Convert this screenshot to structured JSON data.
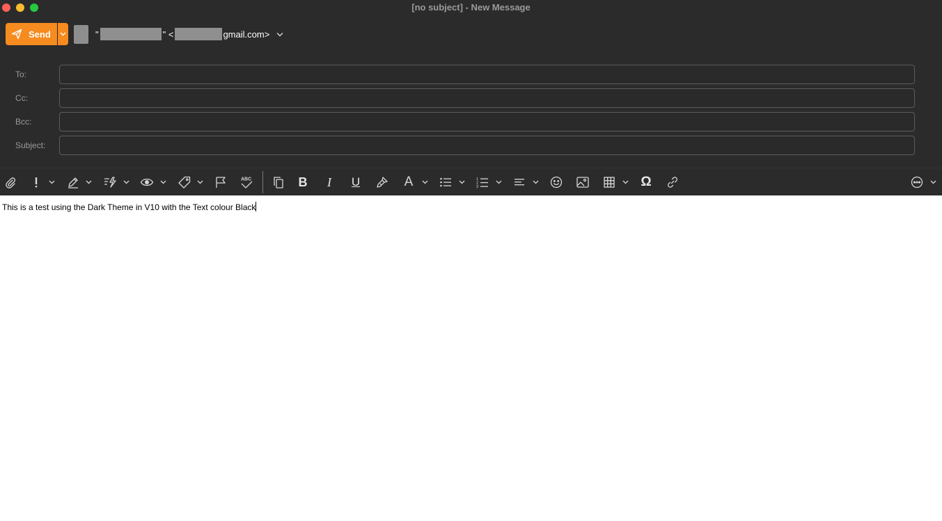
{
  "window": {
    "title": "[no subject] - New Message"
  },
  "send": {
    "label": "Send",
    "color": "#f68b1f"
  },
  "from": {
    "name_prefix": "\"",
    "name_suffix": "\" <",
    "email_suffix": "gmail.com>"
  },
  "fields": {
    "to_label": "To:",
    "cc_label": "Cc:",
    "bcc_label": "Bcc:",
    "subject_label": "Subject:",
    "to_value": "",
    "cc_value": "",
    "bcc_value": "",
    "subject_value": ""
  },
  "toolbar": {
    "icons": [
      "paperclip-icon",
      "importance-icon",
      "signature-icon",
      "quick-parts-icon",
      "read-receipt-icon",
      "category-tag-icon",
      "flag-icon",
      "spellcheck-icon",
      "copy-format-icon",
      "bold-icon",
      "italic-icon",
      "underline-icon",
      "format-painter-icon",
      "font-color-icon",
      "bullet-list-icon",
      "numbered-list-icon",
      "align-icon",
      "emoji-icon",
      "image-icon",
      "table-icon",
      "omega-symbol-icon",
      "link-icon",
      "more-icon"
    ],
    "bold_glyph": "B",
    "italic_glyph": "I",
    "underline_glyph": "U",
    "font_color_glyph": "A",
    "omega_glyph": "Ω"
  },
  "body": {
    "text": "This is a test using the Dark Theme in V10 with the Text colour Black"
  }
}
